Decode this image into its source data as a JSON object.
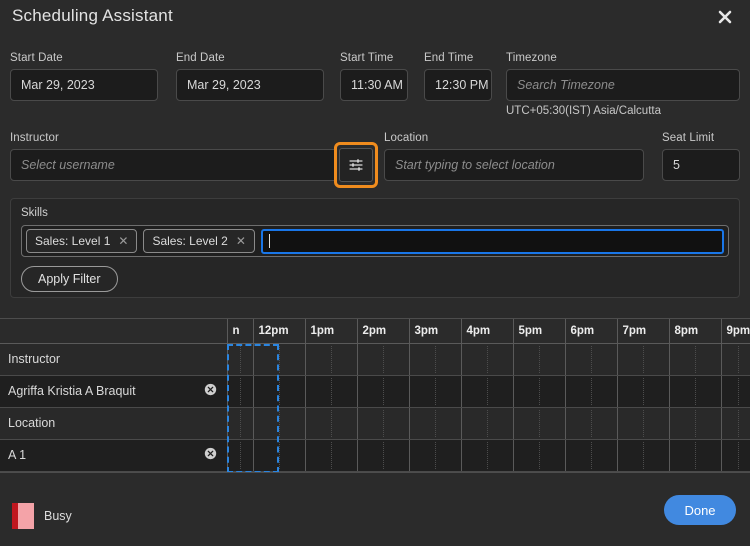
{
  "dialog": {
    "title": "Scheduling Assistant",
    "close_icon": "close-icon"
  },
  "form": {
    "start_date": {
      "label": "Start Date",
      "value": "Mar 29, 2023"
    },
    "end_date": {
      "label": "End Date",
      "value": "Mar 29, 2023"
    },
    "start_time": {
      "label": "Start Time",
      "value": "11:30 AM"
    },
    "end_time": {
      "label": "End Time",
      "value": "12:30 PM"
    },
    "timezone": {
      "label": "Timezone",
      "placeholder": "Search Timezone",
      "value": "",
      "note": "UTC+05:30(IST) Asia/Calcutta"
    },
    "instructor": {
      "label": "Instructor",
      "placeholder": "Select username",
      "value": "",
      "filter_icon": "sliders-filter-icon",
      "filter_highlight_color": "#f08c1e"
    },
    "location": {
      "label": "Location",
      "placeholder": "Start typing to select location",
      "value": ""
    },
    "seat_limit": {
      "label": "Seat Limit",
      "value": "5"
    }
  },
  "skills": {
    "label": "Skills",
    "chips": [
      {
        "label": "Sales: Level 1",
        "remove_icon": "close-icon"
      },
      {
        "label": "Sales: Level 2",
        "remove_icon": "close-icon"
      }
    ],
    "input_value": "",
    "input_focused": true,
    "focus_color": "#1976e8",
    "apply_label": "Apply Filter"
  },
  "timeline": {
    "label_column_header": "",
    "columns": [
      "n",
      "12pm",
      "1pm",
      "2pm",
      "3pm",
      "4pm",
      "5pm",
      "6pm",
      "7pm",
      "8pm",
      "9pm"
    ],
    "rows": [
      {
        "label": "Instructor",
        "type": "group",
        "removable": false
      },
      {
        "label": "Agriffa Kristia A Braquit",
        "type": "item",
        "removable": true,
        "remove_icon": "remove-circle-icon"
      },
      {
        "label": "Location",
        "type": "group",
        "removable": false
      },
      {
        "label": "A 1",
        "type": "item",
        "removable": true,
        "remove_icon": "remove-circle-icon"
      }
    ],
    "selection": {
      "start": "11:30 AM",
      "end": "12:30 PM",
      "color": "#2a85e0"
    }
  },
  "footer": {
    "legend_label": "Busy",
    "legend_fill": "#f4a3a8",
    "legend_stripe": "#c0171f",
    "done_label": "Done",
    "done_color": "#4189e0"
  }
}
